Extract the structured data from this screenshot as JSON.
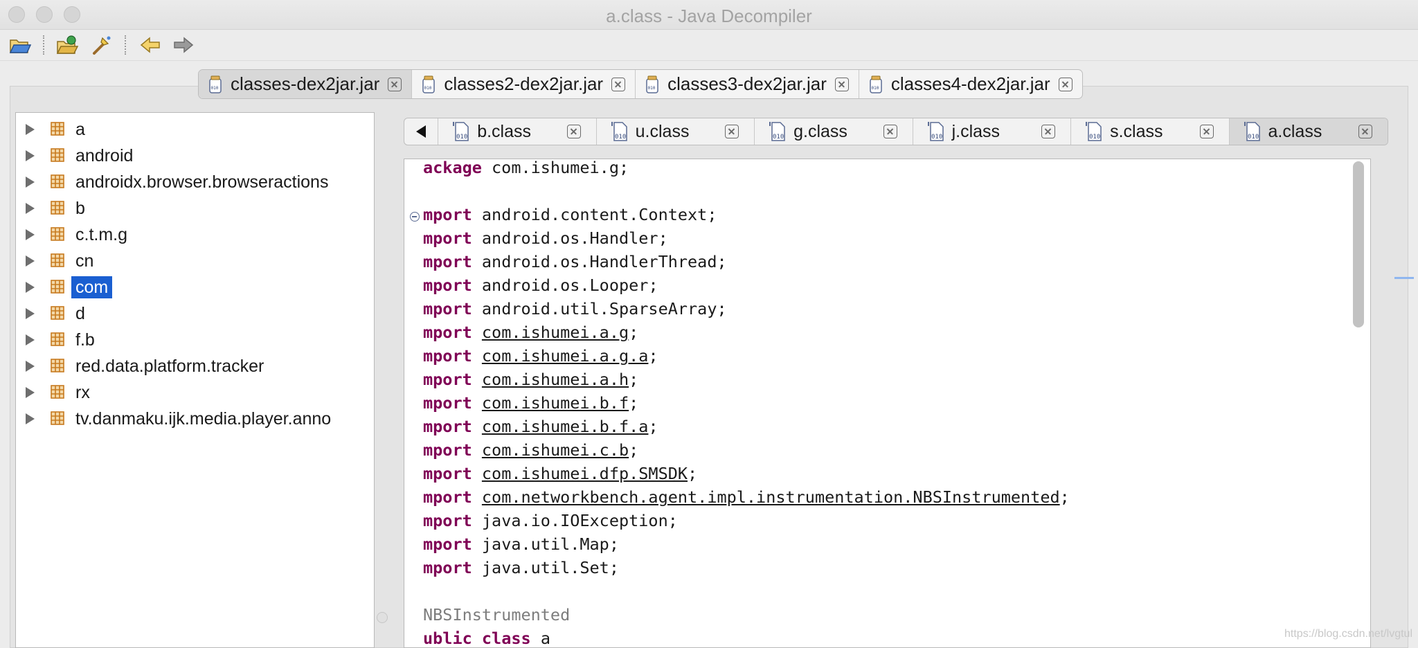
{
  "window": {
    "title": "a.class - Java Decompiler"
  },
  "toolbar": {
    "buttons": [
      "open-file-icon",
      "open-type-icon",
      "search-icon",
      "back-icon",
      "forward-icon"
    ]
  },
  "jar_tabs": [
    {
      "label": "classes-dex2jar.jar",
      "active": true
    },
    {
      "label": "classes2-dex2jar.jar",
      "active": false
    },
    {
      "label": "classes3-dex2jar.jar",
      "active": false
    },
    {
      "label": "classes4-dex2jar.jar",
      "active": false
    }
  ],
  "tree": {
    "packages": [
      "a",
      "android",
      "androidx.browser.browseractions",
      "b",
      "c.t.m.g",
      "cn",
      "com",
      "d",
      "f.b",
      "red.data.platform.tracker",
      "rx",
      "tv.danmaku.ijk.media.player.anno"
    ],
    "selected": "com"
  },
  "class_tabs": [
    {
      "label": "b.class",
      "active": false
    },
    {
      "label": "u.class",
      "active": false
    },
    {
      "label": "g.class",
      "active": false
    },
    {
      "label": "j.class",
      "active": false
    },
    {
      "label": "s.class",
      "active": false
    },
    {
      "label": "a.class",
      "active": true
    }
  ],
  "code": {
    "package_kw": "ackage",
    "package_rest": " com.ishumei.g;",
    "import_kw": "mport",
    "imports": [
      {
        "name": "android.content.Context",
        "link": false
      },
      {
        "name": "android.os.Handler",
        "link": false
      },
      {
        "name": "android.os.HandlerThread",
        "link": false
      },
      {
        "name": "android.os.Looper",
        "link": false
      },
      {
        "name": "android.util.SparseArray",
        "link": false
      },
      {
        "name": "com.ishumei.a.g",
        "link": true
      },
      {
        "name": "com.ishumei.a.g.a",
        "link": true
      },
      {
        "name": "com.ishumei.a.h",
        "link": true
      },
      {
        "name": "com.ishumei.b.f",
        "link": true
      },
      {
        "name": "com.ishumei.b.f.a",
        "link": true
      },
      {
        "name": "com.ishumei.c.b",
        "link": true
      },
      {
        "name": "com.ishumei.dfp.SMSDK",
        "link": true
      },
      {
        "name": "com.networkbench.agent.impl.instrumentation.NBSInstrumented",
        "link": true
      },
      {
        "name": "java.io.IOException",
        "link": false
      },
      {
        "name": "java.util.Map",
        "link": false
      },
      {
        "name": "java.util.Set",
        "link": false
      }
    ],
    "annotation": "NBSInstrumented",
    "class_kw1": "ublic",
    "class_kw2": "class",
    "class_name": "a"
  },
  "watermark": "https://blog.csdn.net/lvgtul",
  "colors": {
    "keyword": "#7f0055",
    "selection": "#1a5fd1",
    "package_icon": "#c77a1e"
  }
}
